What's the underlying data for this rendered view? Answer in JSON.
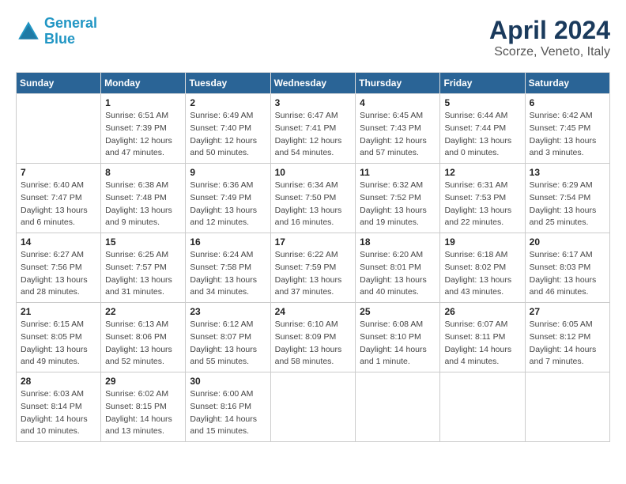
{
  "header": {
    "logo_line1": "General",
    "logo_line2": "Blue",
    "month": "April 2024",
    "location": "Scorze, Veneto, Italy"
  },
  "weekdays": [
    "Sunday",
    "Monday",
    "Tuesday",
    "Wednesday",
    "Thursday",
    "Friday",
    "Saturday"
  ],
  "weeks": [
    [
      {
        "day": "",
        "info": ""
      },
      {
        "day": "1",
        "info": "Sunrise: 6:51 AM\nSunset: 7:39 PM\nDaylight: 12 hours\nand 47 minutes."
      },
      {
        "day": "2",
        "info": "Sunrise: 6:49 AM\nSunset: 7:40 PM\nDaylight: 12 hours\nand 50 minutes."
      },
      {
        "day": "3",
        "info": "Sunrise: 6:47 AM\nSunset: 7:41 PM\nDaylight: 12 hours\nand 54 minutes."
      },
      {
        "day": "4",
        "info": "Sunrise: 6:45 AM\nSunset: 7:43 PM\nDaylight: 12 hours\nand 57 minutes."
      },
      {
        "day": "5",
        "info": "Sunrise: 6:44 AM\nSunset: 7:44 PM\nDaylight: 13 hours\nand 0 minutes."
      },
      {
        "day": "6",
        "info": "Sunrise: 6:42 AM\nSunset: 7:45 PM\nDaylight: 13 hours\nand 3 minutes."
      }
    ],
    [
      {
        "day": "7",
        "info": "Sunrise: 6:40 AM\nSunset: 7:47 PM\nDaylight: 13 hours\nand 6 minutes."
      },
      {
        "day": "8",
        "info": "Sunrise: 6:38 AM\nSunset: 7:48 PM\nDaylight: 13 hours\nand 9 minutes."
      },
      {
        "day": "9",
        "info": "Sunrise: 6:36 AM\nSunset: 7:49 PM\nDaylight: 13 hours\nand 12 minutes."
      },
      {
        "day": "10",
        "info": "Sunrise: 6:34 AM\nSunset: 7:50 PM\nDaylight: 13 hours\nand 16 minutes."
      },
      {
        "day": "11",
        "info": "Sunrise: 6:32 AM\nSunset: 7:52 PM\nDaylight: 13 hours\nand 19 minutes."
      },
      {
        "day": "12",
        "info": "Sunrise: 6:31 AM\nSunset: 7:53 PM\nDaylight: 13 hours\nand 22 minutes."
      },
      {
        "day": "13",
        "info": "Sunrise: 6:29 AM\nSunset: 7:54 PM\nDaylight: 13 hours\nand 25 minutes."
      }
    ],
    [
      {
        "day": "14",
        "info": "Sunrise: 6:27 AM\nSunset: 7:56 PM\nDaylight: 13 hours\nand 28 minutes."
      },
      {
        "day": "15",
        "info": "Sunrise: 6:25 AM\nSunset: 7:57 PM\nDaylight: 13 hours\nand 31 minutes."
      },
      {
        "day": "16",
        "info": "Sunrise: 6:24 AM\nSunset: 7:58 PM\nDaylight: 13 hours\nand 34 minutes."
      },
      {
        "day": "17",
        "info": "Sunrise: 6:22 AM\nSunset: 7:59 PM\nDaylight: 13 hours\nand 37 minutes."
      },
      {
        "day": "18",
        "info": "Sunrise: 6:20 AM\nSunset: 8:01 PM\nDaylight: 13 hours\nand 40 minutes."
      },
      {
        "day": "19",
        "info": "Sunrise: 6:18 AM\nSunset: 8:02 PM\nDaylight: 13 hours\nand 43 minutes."
      },
      {
        "day": "20",
        "info": "Sunrise: 6:17 AM\nSunset: 8:03 PM\nDaylight: 13 hours\nand 46 minutes."
      }
    ],
    [
      {
        "day": "21",
        "info": "Sunrise: 6:15 AM\nSunset: 8:05 PM\nDaylight: 13 hours\nand 49 minutes."
      },
      {
        "day": "22",
        "info": "Sunrise: 6:13 AM\nSunset: 8:06 PM\nDaylight: 13 hours\nand 52 minutes."
      },
      {
        "day": "23",
        "info": "Sunrise: 6:12 AM\nSunset: 8:07 PM\nDaylight: 13 hours\nand 55 minutes."
      },
      {
        "day": "24",
        "info": "Sunrise: 6:10 AM\nSunset: 8:09 PM\nDaylight: 13 hours\nand 58 minutes."
      },
      {
        "day": "25",
        "info": "Sunrise: 6:08 AM\nSunset: 8:10 PM\nDaylight: 14 hours\nand 1 minute."
      },
      {
        "day": "26",
        "info": "Sunrise: 6:07 AM\nSunset: 8:11 PM\nDaylight: 14 hours\nand 4 minutes."
      },
      {
        "day": "27",
        "info": "Sunrise: 6:05 AM\nSunset: 8:12 PM\nDaylight: 14 hours\nand 7 minutes."
      }
    ],
    [
      {
        "day": "28",
        "info": "Sunrise: 6:03 AM\nSunset: 8:14 PM\nDaylight: 14 hours\nand 10 minutes."
      },
      {
        "day": "29",
        "info": "Sunrise: 6:02 AM\nSunset: 8:15 PM\nDaylight: 14 hours\nand 13 minutes."
      },
      {
        "day": "30",
        "info": "Sunrise: 6:00 AM\nSunset: 8:16 PM\nDaylight: 14 hours\nand 15 minutes."
      },
      {
        "day": "",
        "info": ""
      },
      {
        "day": "",
        "info": ""
      },
      {
        "day": "",
        "info": ""
      },
      {
        "day": "",
        "info": ""
      }
    ]
  ]
}
